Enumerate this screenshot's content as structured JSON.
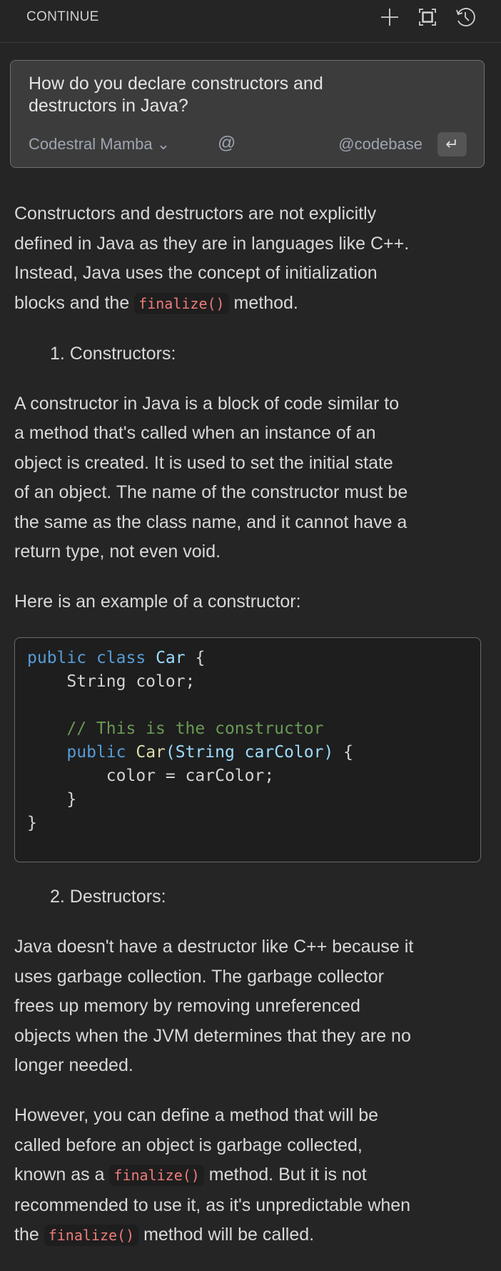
{
  "header": {
    "title": "CONTINUE",
    "icons": [
      "plus-icon",
      "fullscreen-icon",
      "history-icon"
    ]
  },
  "input": {
    "question": [
      "How do you declare constructors and",
      "destructors in Java?"
    ],
    "model": "Codestral Mamba",
    "model_chevron": "⌄",
    "at": "@",
    "codebase": "@codebase",
    "enter": "↵"
  },
  "response": {
    "p1": [
      "Constructors and destructors are not explicitly",
      "defined in Java as they are in languages like C++.",
      "Instead, Java uses the concept of initialization"
    ],
    "p1_last_pre": "blocks and the ",
    "p1_code": "finalize()",
    "p1_last_post": " method.",
    "item1": "1. Constructors:",
    "p2": [
      "A constructor in Java is a block of code similar to",
      "a method that's called when an instance of an",
      "object is created. It is used to set the initial state",
      "of an object. The name of the constructor must be",
      "the same as the class name, and it cannot have a",
      "return type, not even void."
    ],
    "p3": "Here is an example of a constructor:",
    "code": {
      "l1a": "public",
      "l1b": "class",
      "l1c": "Car",
      "l1d": " {",
      "l2": "    String color;",
      "l4": "    // This is the constructor",
      "l5a": "    public",
      "l5b": "Car",
      "l5c": "(String carColor)",
      "l5d": " {",
      "l6": "        color = carColor;",
      "l7": "    }",
      "l8": "}"
    },
    "item2": "2. Destructors:",
    "p4": [
      "Java doesn't have a destructor like C++ because it",
      "uses garbage collection. The garbage collector",
      "frees up memory by removing unreferenced",
      "objects when the JVM determines that they are no",
      "longer needed."
    ],
    "p5": [
      "However, you can define a method that will be",
      "called before an object is garbage collected,"
    ],
    "p5_l3_pre": "known as a ",
    "p5_l3_code": "finalize()",
    "p5_l3_post": " method. But it is not",
    "p5_l4": "recommended to use it, as it's unpredictable when",
    "p5_l5_pre": "the ",
    "p5_l5_code": "finalize()",
    "p5_l5_post": " method will be called."
  }
}
